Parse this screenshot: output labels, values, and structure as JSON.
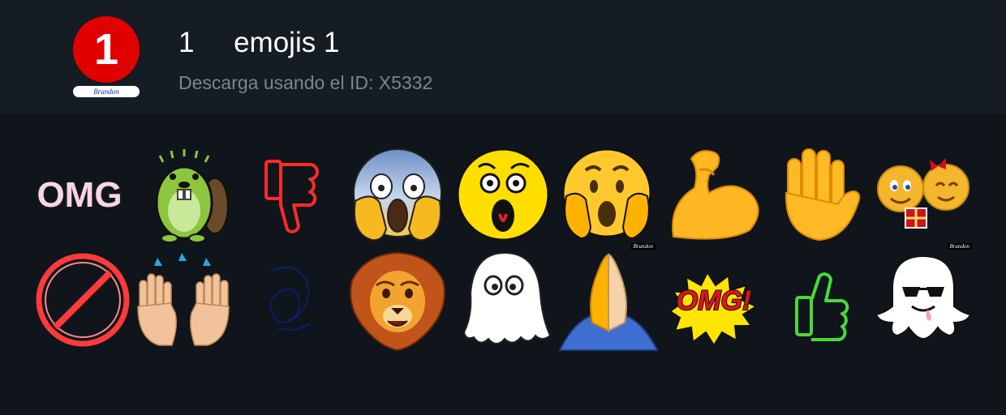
{
  "pack": {
    "logo_number": "1",
    "logo_caption": "Brandon",
    "title": "1     emojis 1",
    "subtitle": "Descarga usando el ID: X5332"
  },
  "stickers": [
    {
      "name": "omg-pink-text",
      "text": "OMG"
    },
    {
      "name": "green-beaver"
    },
    {
      "name": "red-neon-thumbs-down"
    },
    {
      "name": "face-screaming-in-fear"
    },
    {
      "name": "yellow-surprised-face"
    },
    {
      "name": "shocked-face-hands-on-cheeks",
      "caption": "Brandon"
    },
    {
      "name": "flexed-biceps"
    },
    {
      "name": "raised-hand"
    },
    {
      "name": "emoji-couple-with-gift",
      "caption": "Brandon"
    },
    {
      "name": "red-neon-prohibited-sign"
    },
    {
      "name": "raising-hands"
    },
    {
      "name": "dark-blue-scribble"
    },
    {
      "name": "lion-face"
    },
    {
      "name": "ghost"
    },
    {
      "name": "folded-hands"
    },
    {
      "name": "omg-comic-burst",
      "text": "OMG!"
    },
    {
      "name": "green-neon-thumbs-up"
    },
    {
      "name": "ghost-with-sunglasses"
    }
  ],
  "colors": {
    "background": "#0f151b",
    "header_background": "#151c23",
    "logo_red": "#e00000",
    "subtitle_gray": "#7d848c"
  }
}
